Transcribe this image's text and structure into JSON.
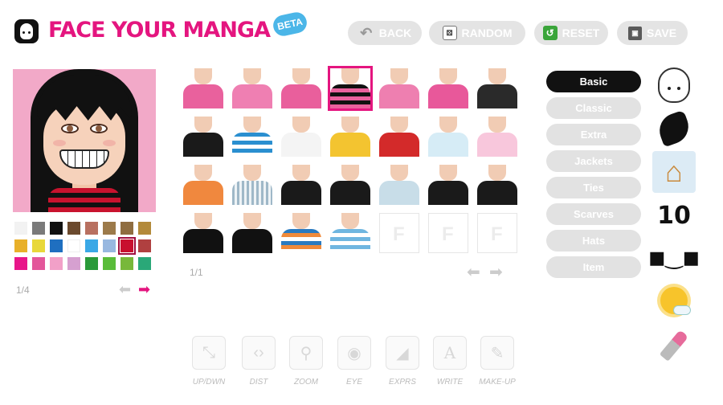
{
  "header": {
    "logo_text": "FACE YOUR MANGA",
    "beta_label": "BETA",
    "buttons": {
      "back": "BACK",
      "random": "RANDOM",
      "reset": "RESET",
      "save": "SAVE"
    }
  },
  "palette": {
    "colors": [
      "#f2f2f2",
      "#7a7a7a",
      "#111111",
      "#6b4a2e",
      "#b87060",
      "#9c7a4a",
      "#8f6d40",
      "#b38a3a",
      "#e8b02a",
      "#e8d83a",
      "#1f6fc0",
      "#ffffff",
      "#3aa8e6",
      "#98b8e0",
      "#c8102e",
      "#b04040",
      "#e8168a",
      "#e3579a",
      "#f2a0c8",
      "#d6a0d0",
      "#2a9a3a",
      "#5abc3a",
      "#78b83a",
      "#2aa878"
    ],
    "selected_index": 14,
    "page": "1/4"
  },
  "grid": {
    "page": "1/1",
    "items": [
      {
        "color": "#e9619d",
        "selected": false
      },
      {
        "color": "#ef7fb2",
        "selected": false
      },
      {
        "color": "#e95f9c",
        "selected": false
      },
      {
        "color": "stripes-black-pink",
        "selected": true
      },
      {
        "color": "#ee7fb0",
        "selected": false
      },
      {
        "color": "#e8589a",
        "selected": false
      },
      {
        "color": "#2a2a2a",
        "selected": false
      },
      {
        "color": "#1a1a1a",
        "selected": false
      },
      {
        "color": "stripes-blue-white",
        "selected": false
      },
      {
        "color": "#f4f4f4",
        "selected": false
      },
      {
        "color": "#f3c430",
        "selected": false
      },
      {
        "color": "#d32a2a",
        "selected": false
      },
      {
        "color": "#d6ecf6",
        "selected": false
      },
      {
        "color": "#f8c7dc",
        "selected": false
      },
      {
        "color": "#f0883e",
        "selected": false
      },
      {
        "color": "stripes-blue-grey",
        "selected": false
      },
      {
        "color": "#1a1a1a",
        "selected": false
      },
      {
        "color": "#1a1a1a",
        "selected": false
      },
      {
        "color": "#c8dde8",
        "selected": false
      },
      {
        "color": "#1a1a1a",
        "selected": false
      },
      {
        "color": "#1a1a1a",
        "selected": false
      },
      {
        "color": "#111111",
        "selected": false
      },
      {
        "color": "#111111",
        "selected": false
      },
      {
        "color": "stripes-blue-orange",
        "selected": false
      },
      {
        "color": "stripes-blue-navy",
        "selected": false
      },
      {
        "color": "empty",
        "selected": false
      },
      {
        "color": "empty",
        "selected": false
      },
      {
        "color": "empty",
        "selected": false
      }
    ]
  },
  "categories": {
    "items": [
      "Basic",
      "Classic",
      "Extra",
      "Jackets",
      "Ties",
      "Scarves",
      "Hats",
      "Item"
    ],
    "active": "Basic"
  },
  "right_bar": {
    "icons": [
      "face-icon",
      "hair-icon",
      "hanger-icon",
      "ten-icon",
      "sunglasses-icon",
      "weather-icon",
      "lipstick-icon"
    ],
    "ten_label": "10",
    "selected": "hanger-icon"
  },
  "toolbar": {
    "tools": [
      {
        "label": "UP/DWN",
        "icon": "up-down-icon"
      },
      {
        "label": "DIST",
        "icon": "distance-icon"
      },
      {
        "label": "ZOOM",
        "icon": "zoom-icon"
      },
      {
        "label": "EYE",
        "icon": "eye-icon"
      },
      {
        "label": "EXPRS",
        "icon": "expression-icon"
      },
      {
        "label": "WRITE",
        "icon": "write-icon"
      },
      {
        "label": "MAKE-UP",
        "icon": "makeup-icon"
      }
    ]
  }
}
